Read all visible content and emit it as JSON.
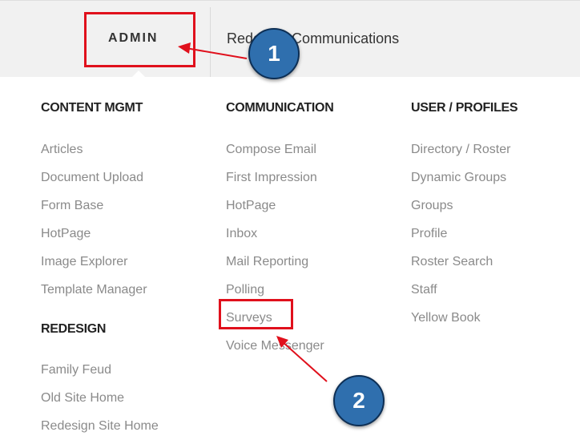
{
  "topnav": {
    "admin_label": "ADMIN",
    "redesign_label": "Redesign Communications"
  },
  "columns": [
    {
      "title": "CONTENT MGMT",
      "items": [
        "Articles",
        "Document Upload",
        "Form Base",
        "HotPage",
        "Image Explorer",
        "Template Manager"
      ]
    },
    {
      "title": "COMMUNICATION",
      "items": [
        "Compose Email",
        "First Impression",
        "HotPage",
        "Inbox",
        "Mail Reporting",
        "Polling",
        "Surveys",
        "Voice Messenger"
      ]
    },
    {
      "title": "USER / PROFILES",
      "items": [
        "Directory / Roster",
        "Dynamic Groups",
        "Groups",
        "Profile",
        "Roster Search",
        "Staff",
        "Yellow Book"
      ]
    },
    {
      "title": "REDESIGN",
      "items": [
        "Family Feud",
        "Old Site Home",
        "Redesign Site Home"
      ]
    }
  ],
  "annotations": {
    "step1": "1",
    "step2": "2",
    "highlight_color": "#e0101c",
    "badge_color": "#2f6fae"
  }
}
